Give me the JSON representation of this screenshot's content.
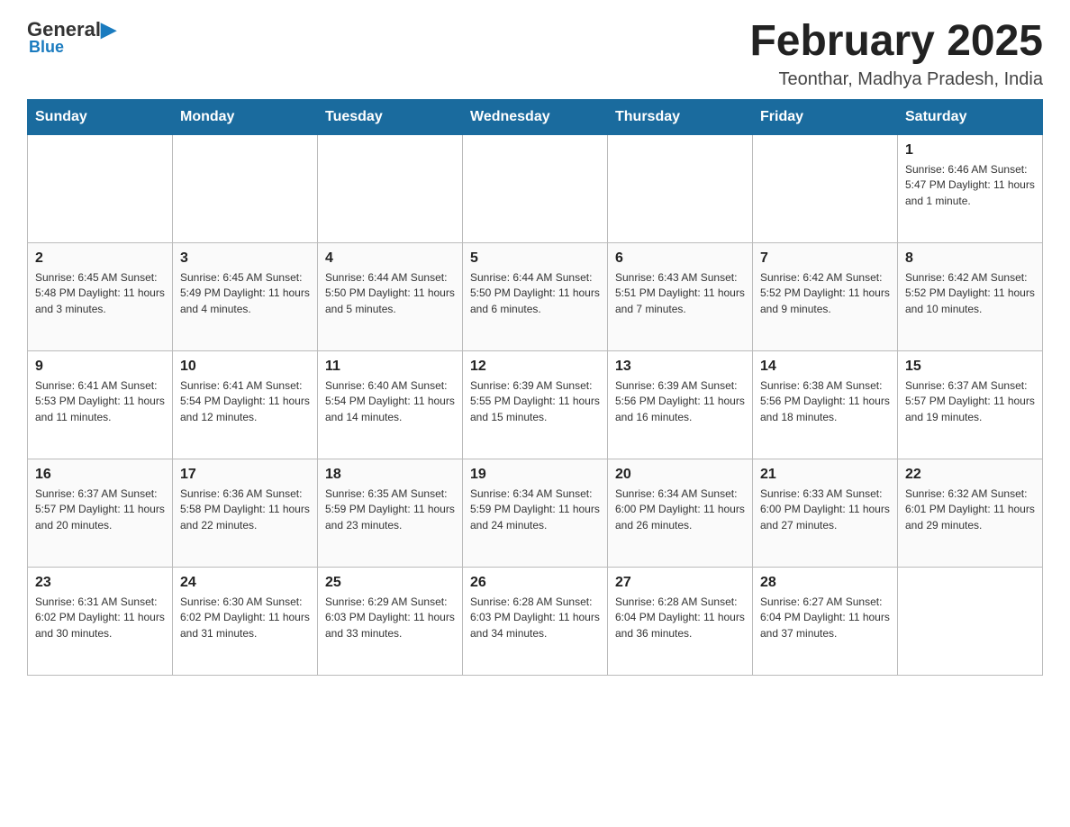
{
  "header": {
    "logo_general": "General",
    "logo_blue": "Blue",
    "month_title": "February 2025",
    "location": "Teonthar, Madhya Pradesh, India"
  },
  "days_of_week": [
    "Sunday",
    "Monday",
    "Tuesday",
    "Wednesday",
    "Thursday",
    "Friday",
    "Saturday"
  ],
  "weeks": [
    [
      {
        "day": "",
        "info": ""
      },
      {
        "day": "",
        "info": ""
      },
      {
        "day": "",
        "info": ""
      },
      {
        "day": "",
        "info": ""
      },
      {
        "day": "",
        "info": ""
      },
      {
        "day": "",
        "info": ""
      },
      {
        "day": "1",
        "info": "Sunrise: 6:46 AM\nSunset: 5:47 PM\nDaylight: 11 hours and 1 minute."
      }
    ],
    [
      {
        "day": "2",
        "info": "Sunrise: 6:45 AM\nSunset: 5:48 PM\nDaylight: 11 hours and 3 minutes."
      },
      {
        "day": "3",
        "info": "Sunrise: 6:45 AM\nSunset: 5:49 PM\nDaylight: 11 hours and 4 minutes."
      },
      {
        "day": "4",
        "info": "Sunrise: 6:44 AM\nSunset: 5:50 PM\nDaylight: 11 hours and 5 minutes."
      },
      {
        "day": "5",
        "info": "Sunrise: 6:44 AM\nSunset: 5:50 PM\nDaylight: 11 hours and 6 minutes."
      },
      {
        "day": "6",
        "info": "Sunrise: 6:43 AM\nSunset: 5:51 PM\nDaylight: 11 hours and 7 minutes."
      },
      {
        "day": "7",
        "info": "Sunrise: 6:42 AM\nSunset: 5:52 PM\nDaylight: 11 hours and 9 minutes."
      },
      {
        "day": "8",
        "info": "Sunrise: 6:42 AM\nSunset: 5:52 PM\nDaylight: 11 hours and 10 minutes."
      }
    ],
    [
      {
        "day": "9",
        "info": "Sunrise: 6:41 AM\nSunset: 5:53 PM\nDaylight: 11 hours and 11 minutes."
      },
      {
        "day": "10",
        "info": "Sunrise: 6:41 AM\nSunset: 5:54 PM\nDaylight: 11 hours and 12 minutes."
      },
      {
        "day": "11",
        "info": "Sunrise: 6:40 AM\nSunset: 5:54 PM\nDaylight: 11 hours and 14 minutes."
      },
      {
        "day": "12",
        "info": "Sunrise: 6:39 AM\nSunset: 5:55 PM\nDaylight: 11 hours and 15 minutes."
      },
      {
        "day": "13",
        "info": "Sunrise: 6:39 AM\nSunset: 5:56 PM\nDaylight: 11 hours and 16 minutes."
      },
      {
        "day": "14",
        "info": "Sunrise: 6:38 AM\nSunset: 5:56 PM\nDaylight: 11 hours and 18 minutes."
      },
      {
        "day": "15",
        "info": "Sunrise: 6:37 AM\nSunset: 5:57 PM\nDaylight: 11 hours and 19 minutes."
      }
    ],
    [
      {
        "day": "16",
        "info": "Sunrise: 6:37 AM\nSunset: 5:57 PM\nDaylight: 11 hours and 20 minutes."
      },
      {
        "day": "17",
        "info": "Sunrise: 6:36 AM\nSunset: 5:58 PM\nDaylight: 11 hours and 22 minutes."
      },
      {
        "day": "18",
        "info": "Sunrise: 6:35 AM\nSunset: 5:59 PM\nDaylight: 11 hours and 23 minutes."
      },
      {
        "day": "19",
        "info": "Sunrise: 6:34 AM\nSunset: 5:59 PM\nDaylight: 11 hours and 24 minutes."
      },
      {
        "day": "20",
        "info": "Sunrise: 6:34 AM\nSunset: 6:00 PM\nDaylight: 11 hours and 26 minutes."
      },
      {
        "day": "21",
        "info": "Sunrise: 6:33 AM\nSunset: 6:00 PM\nDaylight: 11 hours and 27 minutes."
      },
      {
        "day": "22",
        "info": "Sunrise: 6:32 AM\nSunset: 6:01 PM\nDaylight: 11 hours and 29 minutes."
      }
    ],
    [
      {
        "day": "23",
        "info": "Sunrise: 6:31 AM\nSunset: 6:02 PM\nDaylight: 11 hours and 30 minutes."
      },
      {
        "day": "24",
        "info": "Sunrise: 6:30 AM\nSunset: 6:02 PM\nDaylight: 11 hours and 31 minutes."
      },
      {
        "day": "25",
        "info": "Sunrise: 6:29 AM\nSunset: 6:03 PM\nDaylight: 11 hours and 33 minutes."
      },
      {
        "day": "26",
        "info": "Sunrise: 6:28 AM\nSunset: 6:03 PM\nDaylight: 11 hours and 34 minutes."
      },
      {
        "day": "27",
        "info": "Sunrise: 6:28 AM\nSunset: 6:04 PM\nDaylight: 11 hours and 36 minutes."
      },
      {
        "day": "28",
        "info": "Sunrise: 6:27 AM\nSunset: 6:04 PM\nDaylight: 11 hours and 37 minutes."
      },
      {
        "day": "",
        "info": ""
      }
    ]
  ]
}
